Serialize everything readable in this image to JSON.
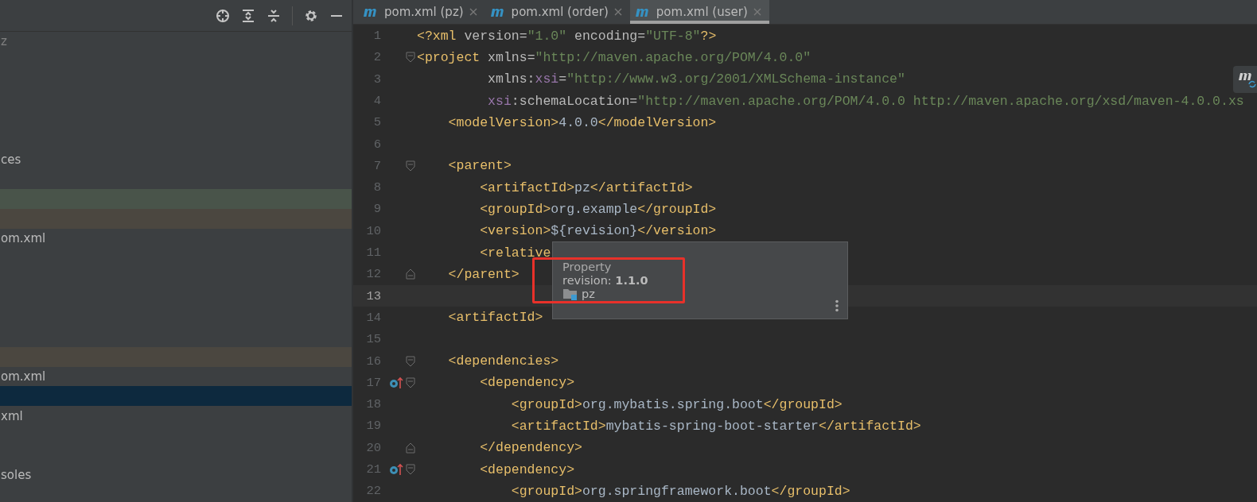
{
  "project_panel": {
    "rows": [
      {
        "label": "z",
        "dimmed": true,
        "selected": false
      },
      {
        "label": "ces",
        "dimmed": false,
        "selected": false
      },
      {
        "selected": false,
        "color": "#49544a"
      },
      {
        "selected": false,
        "color": "#4b4740"
      },
      {
        "label": "om.xml",
        "dimmed": false,
        "selected": false
      },
      {
        "selected": false,
        "color": "#4b4740"
      },
      {
        "label": "om.xml",
        "dimmed": false,
        "selected": false
      },
      {
        "selected": true
      },
      {
        "label": "xml",
        "dimmed": false,
        "selected": false
      },
      {
        "label": "soles",
        "dimmed": false,
        "selected": false
      }
    ]
  },
  "tabs": [
    {
      "label": "pom.xml (pz)",
      "selected": false
    },
    {
      "label": "pom.xml (order)",
      "selected": false
    },
    {
      "label": "pom.xml (user)",
      "selected": true
    }
  ],
  "editor": {
    "lines": [
      {
        "number": "1",
        "tokens": [
          {
            "kind": "tag",
            "text": "<?xml"
          },
          {
            "kind": "attr",
            "text": " version="
          },
          {
            "kind": "str",
            "text": "\"1.0\""
          },
          {
            "kind": "attr",
            "text": " encoding="
          },
          {
            "kind": "str",
            "text": "\"UTF-8\""
          },
          {
            "kind": "tag",
            "text": "?>"
          }
        ]
      },
      {
        "number": "2",
        "fold_start": true,
        "tokens": [
          {
            "kind": "tag",
            "text": "<project"
          },
          {
            "kind": "attr",
            "text": " xmlns="
          },
          {
            "kind": "str",
            "text": "\"http://maven.apache.org/POM/4.0.0\""
          }
        ]
      },
      {
        "number": "3",
        "tokens": [
          {
            "kind": "attr",
            "text": "         xmlns:"
          },
          {
            "kind": "ns",
            "text": "xsi"
          },
          {
            "kind": "attr",
            "text": "="
          },
          {
            "kind": "str",
            "text": "\"http://www.w3.org/2001/XMLSchema-instance\""
          }
        ]
      },
      {
        "number": "4",
        "tokens": [
          {
            "kind": "ns",
            "text": "         xsi"
          },
          {
            "kind": "attr",
            "text": ":schemaLocation="
          },
          {
            "kind": "str",
            "text": "\"http://maven.apache.org/POM/4.0.0 http://maven.apache.org/xsd/maven-4.0.0.xs"
          }
        ]
      },
      {
        "number": "5",
        "tokens": [
          {
            "kind": "tag",
            "text": "    <modelVersion>"
          },
          {
            "kind": "text",
            "text": "4.0.0"
          },
          {
            "kind": "tag",
            "text": "</modelVersion>"
          }
        ]
      },
      {
        "number": "6"
      },
      {
        "number": "7",
        "fold_start": true,
        "tokens": [
          {
            "kind": "tag",
            "text": "    <parent>"
          }
        ]
      },
      {
        "number": "8",
        "tokens": [
          {
            "kind": "tag",
            "text": "        <artifactId>"
          },
          {
            "kind": "text",
            "text": "pz"
          },
          {
            "kind": "tag",
            "text": "</artifactId>"
          }
        ]
      },
      {
        "number": "9",
        "tokens": [
          {
            "kind": "tag",
            "text": "        <groupId>"
          },
          {
            "kind": "text",
            "text": "org.example"
          },
          {
            "kind": "tag",
            "text": "</groupId>"
          }
        ]
      },
      {
        "number": "10",
        "tokens": [
          {
            "kind": "tag",
            "text": "        <version>"
          },
          {
            "kind": "text",
            "text": "${revision}"
          },
          {
            "kind": "tag",
            "text": "</version>"
          }
        ]
      },
      {
        "number": "11",
        "tokens": [
          {
            "kind": "tag",
            "text": "        <relative"
          }
        ]
      },
      {
        "number": "12",
        "fold_end": true,
        "tokens": [
          {
            "kind": "tag",
            "text": "    </parent>"
          }
        ]
      },
      {
        "number": "13",
        "current": true
      },
      {
        "number": "14",
        "tokens": [
          {
            "kind": "tag",
            "text": "    <artifactId>"
          }
        ]
      },
      {
        "number": "15"
      },
      {
        "number": "16",
        "fold_start": true,
        "tokens": [
          {
            "kind": "tag",
            "text": "    <dependencies>"
          }
        ]
      },
      {
        "number": "17",
        "fold_start": true,
        "mark": true,
        "tokens": [
          {
            "kind": "tag",
            "text": "        <dependency>"
          }
        ]
      },
      {
        "number": "18",
        "tokens": [
          {
            "kind": "tag",
            "text": "            <groupId>"
          },
          {
            "kind": "text",
            "text": "org.mybatis.spring.boot"
          },
          {
            "kind": "tag",
            "text": "</groupId>"
          }
        ]
      },
      {
        "number": "19",
        "tokens": [
          {
            "kind": "tag",
            "text": "            <artifactId>"
          },
          {
            "kind": "text",
            "text": "mybatis-spring-boot-starter"
          },
          {
            "kind": "tag",
            "text": "</artifactId>"
          }
        ]
      },
      {
        "number": "20",
        "fold_end": true,
        "tokens": [
          {
            "kind": "tag",
            "text": "        </dependency>"
          }
        ]
      },
      {
        "number": "21",
        "fold_start": true,
        "mark": true,
        "tokens": [
          {
            "kind": "tag",
            "text": "        <dependency>"
          }
        ]
      },
      {
        "number": "22",
        "tokens": [
          {
            "kind": "tag",
            "text": "            <groupId>"
          },
          {
            "kind": "text",
            "text": "org.springframework.boot"
          },
          {
            "kind": "tag",
            "text": "</groupId>"
          }
        ]
      }
    ]
  },
  "tooltip": {
    "title": "Property",
    "text": "revision: **1.1.0**",
    "module": "pz"
  }
}
